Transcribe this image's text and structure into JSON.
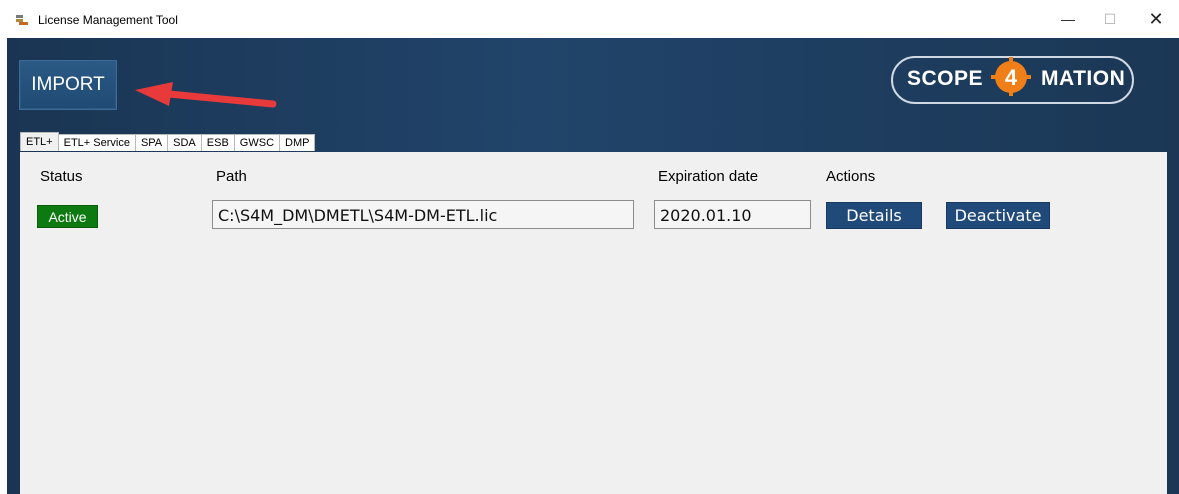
{
  "window": {
    "title": "License Management Tool",
    "minimize": "—",
    "maximize": "☐",
    "close": "✕"
  },
  "toolbar": {
    "import_label": "IMPORT"
  },
  "logo": {
    "left_text": "SCOPE",
    "badge_text": "4",
    "right_text": "MATION"
  },
  "tabs": [
    "ETL+",
    "ETL+ Service",
    "SPA",
    "SDA",
    "ESB",
    "GWSC",
    "DMP"
  ],
  "table": {
    "headers": {
      "status": "Status",
      "path": "Path",
      "expiration": "Expiration date",
      "actions": "Actions"
    },
    "rows": [
      {
        "status": "Active",
        "path": "C:\\S4M_DM\\DMETL\\S4M-DM-ETL.lic",
        "expiration": "2020.01.10",
        "details_label": "Details",
        "deactivate_label": "Deactivate"
      }
    ]
  },
  "colors": {
    "background": "#1c3a58",
    "status_active": "#0c7a11",
    "button": "#1f4a7a",
    "arrow": "#e83a3a",
    "logo_badge": "#f07f1a"
  }
}
